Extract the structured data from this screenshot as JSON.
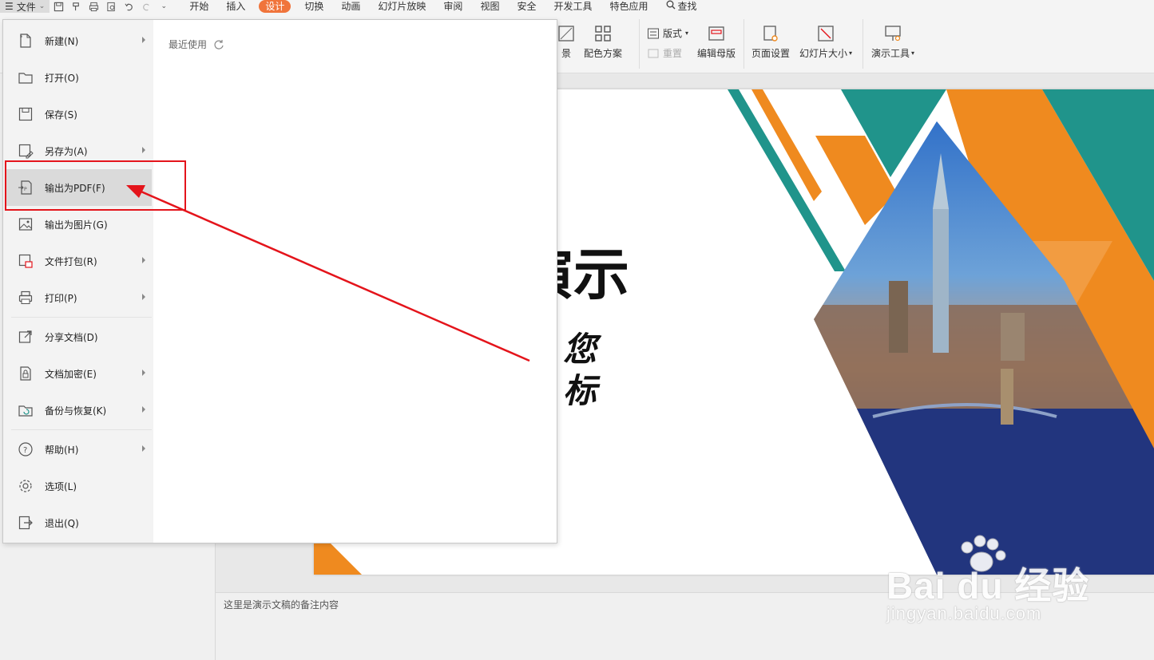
{
  "menubar": {
    "file_label": "文件",
    "tabs": [
      {
        "label": "开始",
        "active": false
      },
      {
        "label": "插入",
        "active": false
      },
      {
        "label": "设计",
        "active": true
      },
      {
        "label": "切换",
        "active": false
      },
      {
        "label": "动画",
        "active": false
      },
      {
        "label": "幻灯片放映",
        "active": false
      },
      {
        "label": "审阅",
        "active": false
      },
      {
        "label": "视图",
        "active": false
      },
      {
        "label": "安全",
        "active": false
      },
      {
        "label": "开发工具",
        "active": false
      },
      {
        "label": "特色应用",
        "active": false
      }
    ],
    "search_label": "查找",
    "accent_color": "#f0743b"
  },
  "ribbon": {
    "background_partial": "景",
    "color_scheme": "配色方案",
    "layout": "版式",
    "reset": "重置",
    "edit_master": "编辑母版",
    "page_setup": "页面设置",
    "slide_size": "幻灯片大小",
    "presentation_tools": "演示工具"
  },
  "file_menu": {
    "items": [
      {
        "label": "新建(N)",
        "icon": "new-file-icon",
        "arrow": true
      },
      {
        "label": "打开(O)",
        "icon": "folder-open-icon",
        "arrow": false
      },
      {
        "label": "保存(S)",
        "icon": "save-icon",
        "arrow": false
      },
      {
        "label": "另存为(A)",
        "icon": "save-as-icon",
        "arrow": true
      },
      {
        "label": "输出为PDF(F)",
        "icon": "export-pdf-icon",
        "arrow": false
      },
      {
        "label": "输出为图片(G)",
        "icon": "export-image-icon",
        "arrow": false
      },
      {
        "label": "文件打包(R)",
        "icon": "package-icon",
        "arrow": true
      },
      {
        "label": "打印(P)",
        "icon": "print-icon",
        "arrow": true
      },
      {
        "label": "分享文档(D)",
        "icon": "share-icon",
        "arrow": false
      },
      {
        "label": "文档加密(E)",
        "icon": "encrypt-icon",
        "arrow": true
      },
      {
        "label": "备份与恢复(K)",
        "icon": "backup-icon",
        "arrow": true
      },
      {
        "label": "帮助(H)",
        "icon": "help-icon",
        "arrow": true
      },
      {
        "label": "选项(L)",
        "icon": "gear-icon",
        "arrow": false
      },
      {
        "label": "退出(Q)",
        "icon": "exit-icon",
        "arrow": false
      }
    ],
    "recent_label": "最近使用"
  },
  "slide": {
    "title_partial": "演示",
    "line1_partial": "您",
    "line2_partial": "标",
    "colors": {
      "orange": "#ef8a1f",
      "teal": "#20948b"
    }
  },
  "notes": {
    "text": "这里是演示文稿的备注内容"
  },
  "watermark": {
    "brand": "Bai du 经验",
    "url": "jingyan.baidu.com"
  },
  "annotation": {
    "color": "#e4141b"
  }
}
